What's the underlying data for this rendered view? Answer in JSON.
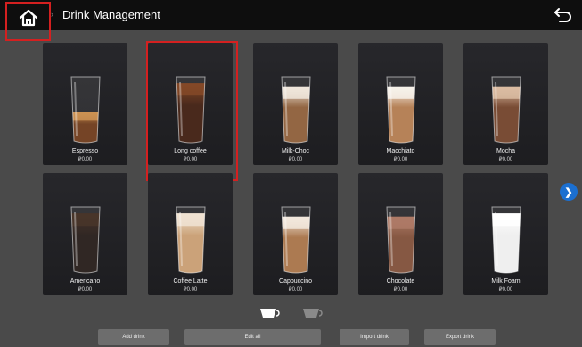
{
  "header": {
    "title": "Drink Management",
    "home_icon": "home-icon",
    "back_icon": "return-arrow-icon",
    "separator": "›"
  },
  "drinks": [
    {
      "name": "Espresso",
      "price": "₽0.00",
      "fill": "#6a3514",
      "top": "#c98a45",
      "level": 0.45
    },
    {
      "name": "Long coffee",
      "price": "₽0.00",
      "fill": "#3a1709",
      "top": "#7a3a15",
      "level": 0.9
    },
    {
      "name": "Milk-Choc",
      "price": "₽0.00",
      "fill": "#8a5a34",
      "top": "#f0e6da",
      "level": 0.85
    },
    {
      "name": "Macchiato",
      "price": "₽0.00",
      "fill": "#b0784a",
      "top": "#f7f2ea",
      "level": 0.85
    },
    {
      "name": "Mocha",
      "price": "₽0.00",
      "fill": "#6e3d24",
      "top": "#d9b89c",
      "level": 0.85
    },
    {
      "name": "Americano",
      "price": "₽0.00",
      "fill": "#1f1512",
      "top": "#3a2418",
      "level": 0.9
    },
    {
      "name": "Coffee Latte",
      "price": "₽0.00",
      "fill": "#c79b6e",
      "top": "#efe1cf",
      "level": 0.9
    },
    {
      "name": "Cappuccino",
      "price": "₽0.00",
      "fill": "#a56f43",
      "top": "#f2e8dc",
      "level": 0.85
    },
    {
      "name": "Chocolate",
      "price": "₽0.00",
      "fill": "#7c4a33",
      "top": "#a8705a",
      "level": 0.85
    },
    {
      "name": "Milk Foam",
      "price": "₽0.00",
      "fill": "#eeeeee",
      "top": "#ffffff",
      "level": 0.9
    }
  ],
  "pagination": {
    "current_icon": "cup-icon-active",
    "other_icon": "cup-icon-inactive",
    "next_icon": "chevron-right-icon",
    "next_glyph": "❯"
  },
  "actions": {
    "add": "Add drink",
    "edit_all": "Edit all",
    "import": "Import drink",
    "export": "Export drink"
  },
  "selected_index": 1,
  "colors": {
    "highlight": "#d42020",
    "accent": "#1b6fd0",
    "background": "#4a4a4a",
    "topbar": "#0e0e0e"
  }
}
